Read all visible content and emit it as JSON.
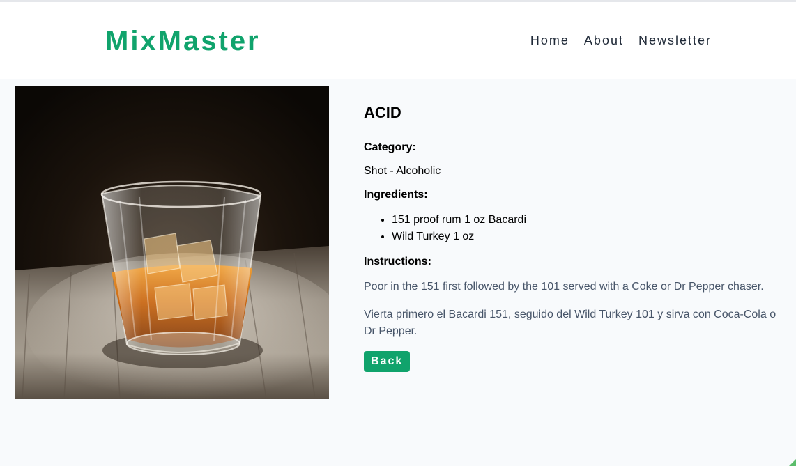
{
  "brand": {
    "name": "MixMaster",
    "color": "#10a36c"
  },
  "nav": {
    "items": [
      {
        "label": "Home"
      },
      {
        "label": "About"
      },
      {
        "label": "Newsletter"
      }
    ]
  },
  "drink": {
    "image_icon": "whiskey-glass-photo",
    "name": "ACID",
    "category_label": "Category:",
    "category": "Shot - Alcoholic",
    "ingredients_label": "Ingredients:",
    "ingredients": [
      "151 proof rum 1 oz Bacardi",
      "Wild Turkey 1 oz"
    ],
    "instructions_label": "Instructions:",
    "instructions_en": "Poor in the 151 first followed by the 101 served with a Coke or Dr Pepper chaser.",
    "instructions_es": "Vierta primero el Bacardi 151, seguido del Wild Turkey 101 y sirva con Coca-Cola o Dr Pepper."
  },
  "back_button": {
    "label": "Back",
    "color": "#10a36c"
  }
}
